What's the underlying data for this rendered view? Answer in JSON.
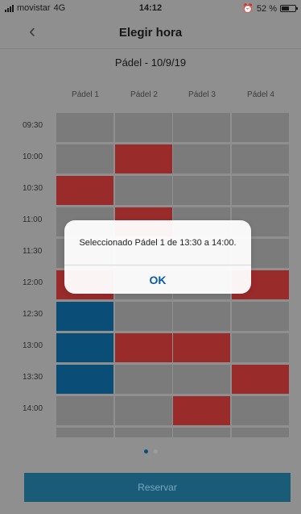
{
  "status_bar": {
    "carrier": "movistar",
    "network": "4G",
    "time": "14:12",
    "battery_percent": "52 %"
  },
  "nav": {
    "title": "Elegir hora"
  },
  "date_title": "Pádel - 10/9/19",
  "courts": [
    "Pádel 1",
    "Pádel 2",
    "Pádel 3",
    "Pádel 4"
  ],
  "time_slots": [
    "09:30",
    "10:00",
    "10:30",
    "11:00",
    "11:30",
    "12:00",
    "12:30",
    "13:00",
    "13:30",
    "14:00"
  ],
  "schedule": [
    [
      "free",
      "free",
      "free",
      "free"
    ],
    [
      "free",
      "reserved",
      "free",
      "free"
    ],
    [
      "reserved",
      "free",
      "free",
      "free"
    ],
    [
      "free",
      "reserved",
      "free",
      "free"
    ],
    [
      "free",
      "free",
      "free",
      "free"
    ],
    [
      "reserved",
      "free",
      "free",
      "reserved"
    ],
    [
      "selected",
      "free",
      "free",
      "free"
    ],
    [
      "selected",
      "reserved",
      "reserved",
      "free"
    ],
    [
      "selected",
      "free",
      "free",
      "reserved"
    ],
    [
      "free",
      "free",
      "reserved",
      "free"
    ],
    [
      "free",
      "free",
      "free",
      "free"
    ]
  ],
  "pager": {
    "active_page": 1,
    "total_pages": 2
  },
  "actions": {
    "reserve": "Reservar"
  },
  "alert": {
    "message": "Seleccionado Pádel 1 de 13:30 a 14:00.",
    "ok": "OK"
  },
  "colors": {
    "background": "#8f8f8f",
    "reserved": "#9a2b2b",
    "selected": "#0a4e78",
    "free": "#7b7b7b",
    "primary_button": "#1a5b78",
    "alert_action": "#0a5aa8"
  },
  "icons": {
    "signal": "signal-bars-icon",
    "alarm": "alarm-clock-icon",
    "battery": "battery-icon",
    "back": "chevron-left-icon"
  }
}
